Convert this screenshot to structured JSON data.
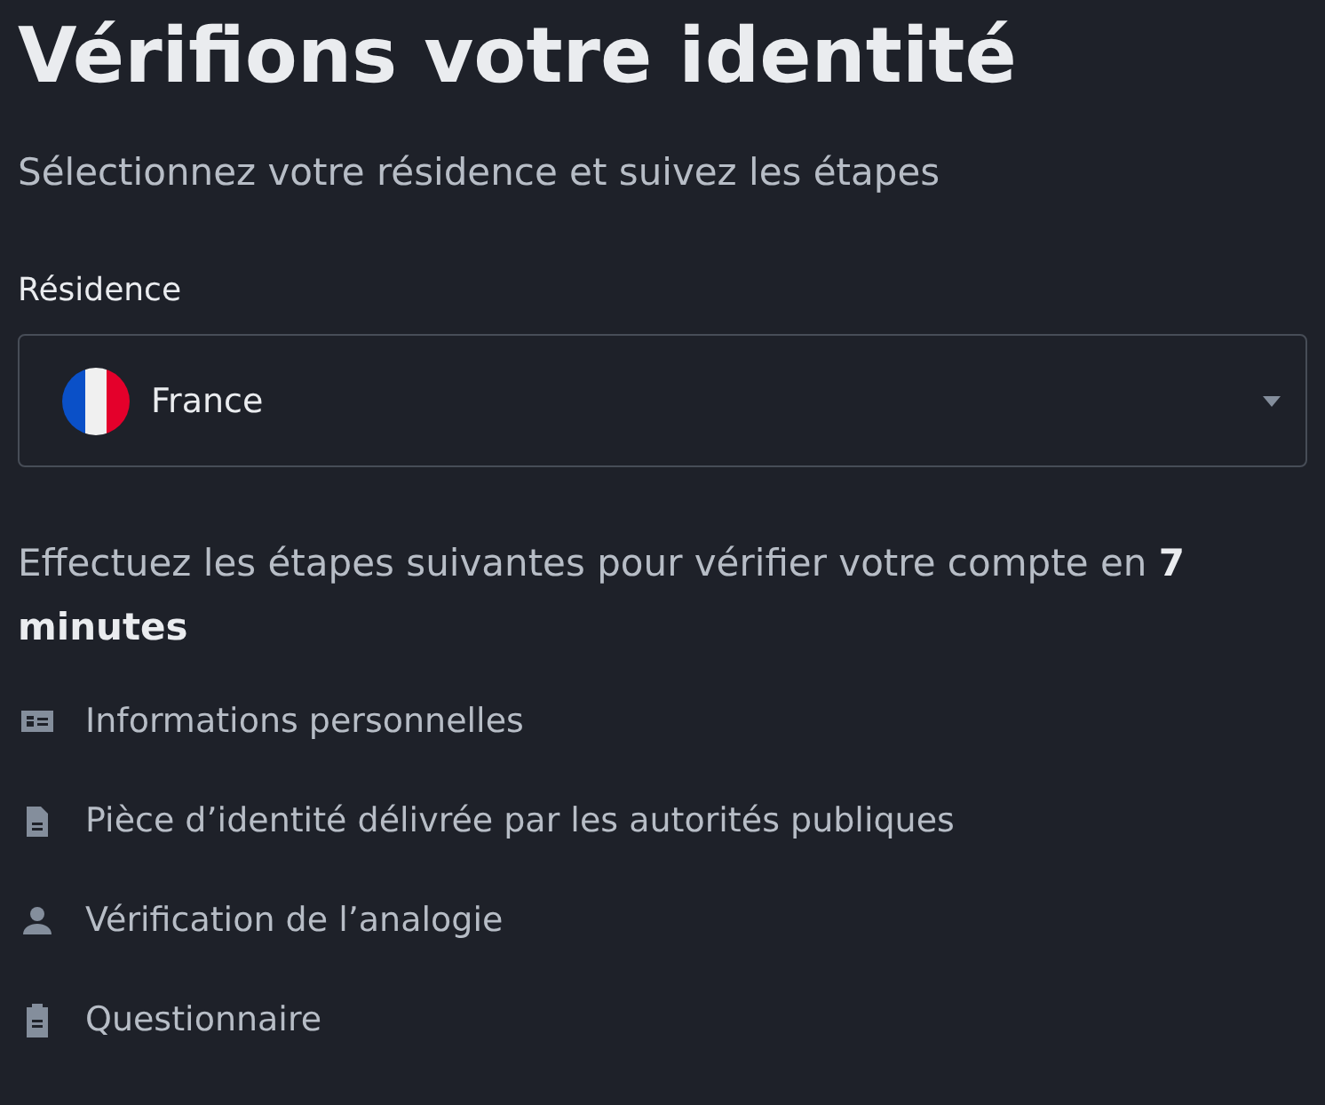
{
  "title": "Vérifions votre identité",
  "subtitle": "Sélectionnez votre résidence et suivez les étapes",
  "residence": {
    "label": "Résidence",
    "value": "France"
  },
  "instructions": "Effectuez les étapes suivantes pour vérifier votre compte en **7 minutes**",
  "steps": [
    {
      "kind": "card",
      "label": "Informations personnelles"
    },
    {
      "kind": "document",
      "label": "Pièce d’identité délivrée par les autorités publiques"
    },
    {
      "kind": "person",
      "label": "Vérification de l’analogie"
    },
    {
      "kind": "clipboard",
      "label": "Questionnaire"
    }
  ]
}
